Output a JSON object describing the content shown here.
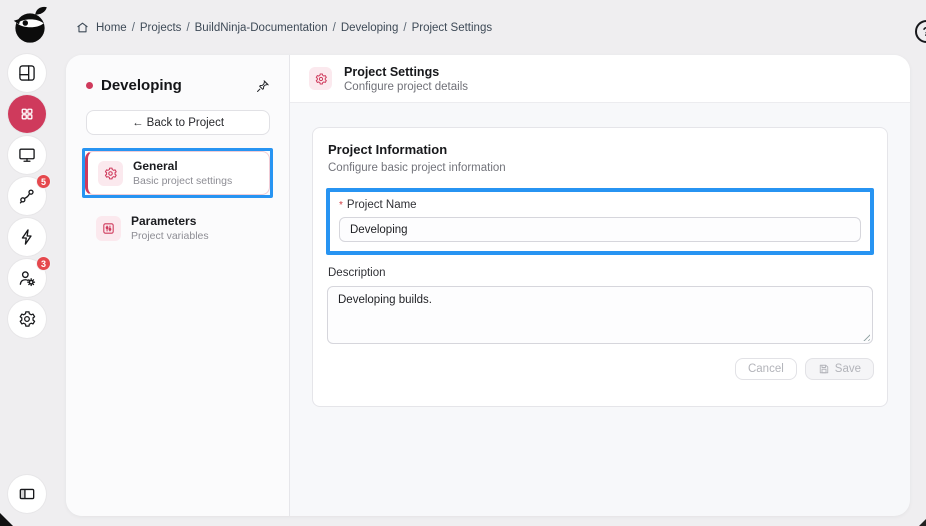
{
  "colors": {
    "accent": "#cf3a5c",
    "highlight_blue": "#2794f2",
    "badge_red": "#e5484d",
    "avatar_yellow": "#f2bd3a"
  },
  "topbar": {
    "breadcrumb": {
      "items": [
        "Home",
        "Projects",
        "BuildNinja-Documentation",
        "Developing",
        "Project Settings"
      ],
      "separator": "/"
    },
    "help_label": "?"
  },
  "rail": {
    "pipeline_badge": "5",
    "users_badge": "3"
  },
  "project_panel": {
    "title": "Developing",
    "back_arrow": "←",
    "back_label": "Back to Project",
    "nav": [
      {
        "label": "General",
        "description": "Basic project settings"
      },
      {
        "label": "Parameters",
        "description": "Project variables"
      }
    ]
  },
  "main": {
    "header": {
      "title": "Project Settings",
      "subtitle": "Configure project details"
    },
    "card": {
      "title": "Project Information",
      "subtitle": "Configure basic project information",
      "name_field": {
        "required_marker": "*",
        "label": "Project Name",
        "value": "Developing"
      },
      "description_field": {
        "label": "Description",
        "value": "Developing builds."
      },
      "cancel_label": "Cancel",
      "save_label": "Save"
    }
  }
}
